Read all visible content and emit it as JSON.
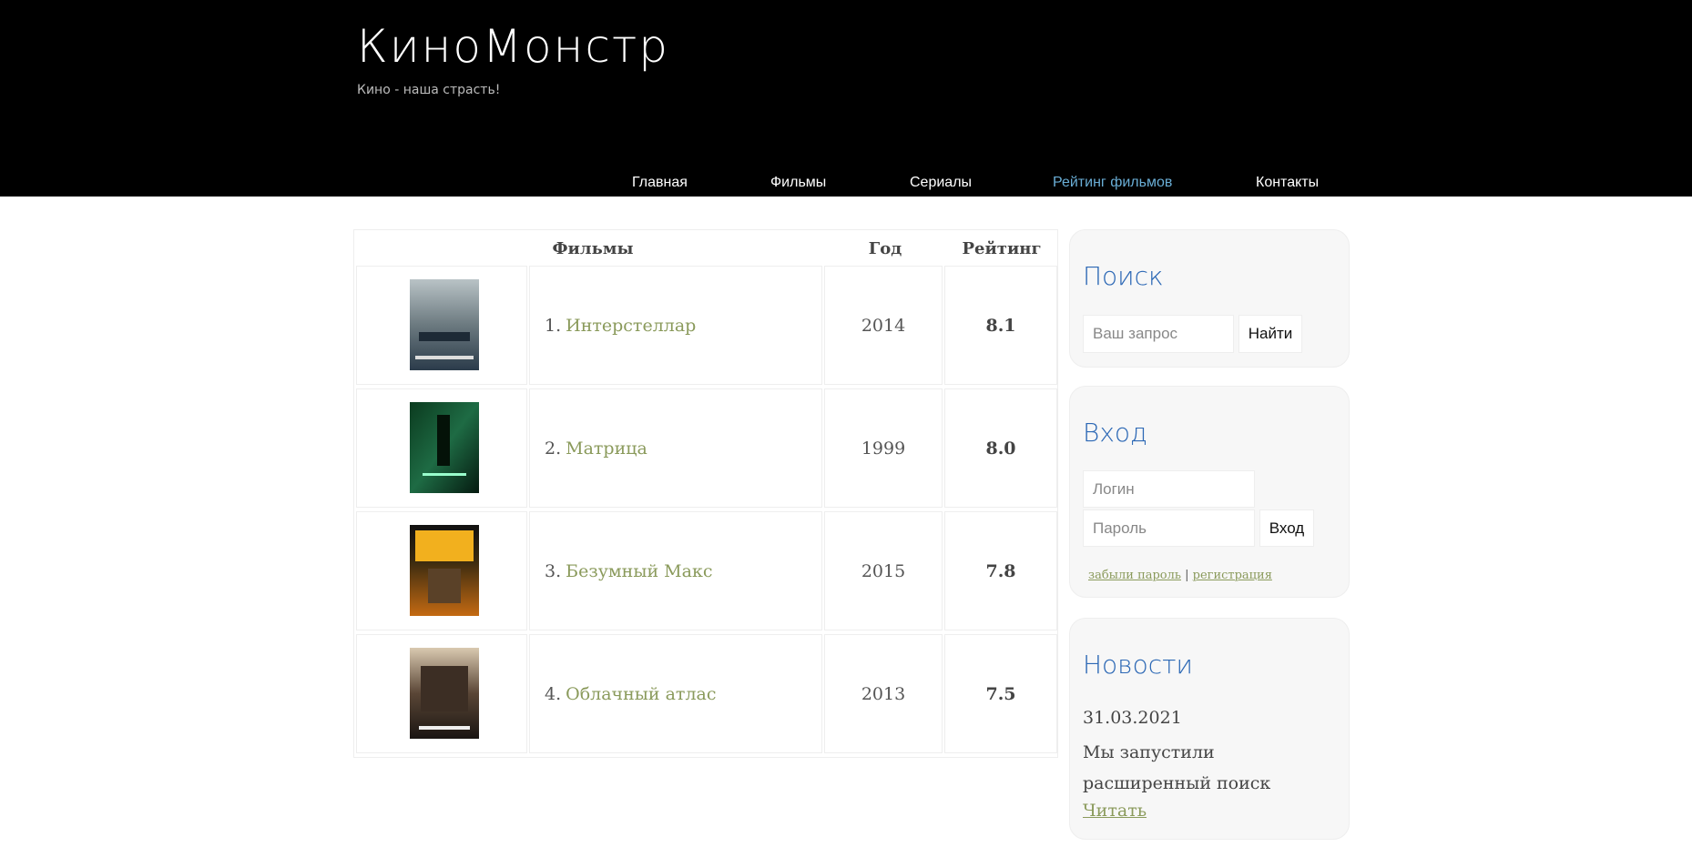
{
  "site": {
    "title": "КиноМонстр",
    "tagline": "Кино - наша страсть!"
  },
  "nav": [
    {
      "label": "Главная",
      "active": false
    },
    {
      "label": "Фильмы",
      "active": false
    },
    {
      "label": "Сериалы",
      "active": false
    },
    {
      "label": "Рейтинг фильмов",
      "active": true
    },
    {
      "label": "Контакты",
      "active": false
    }
  ],
  "table": {
    "headers": {
      "films": "Фильмы",
      "year": "Год",
      "rating": "Рейтинг"
    },
    "rows": [
      {
        "num": "1.",
        "title": "Интерстеллар",
        "year": "2014",
        "rating": "8.1",
        "poster": "poster-interstellar"
      },
      {
        "num": "2.",
        "title": "Матрица",
        "year": "1999",
        "rating": "8.0",
        "poster": "poster-matrix"
      },
      {
        "num": "3.",
        "title": "Безумный Макс",
        "year": "2015",
        "rating": "7.8",
        "poster": "poster-mad-max"
      },
      {
        "num": "4.",
        "title": "Облачный атлас",
        "year": "2013",
        "rating": "7.5",
        "poster": "poster-cloud-atlas"
      }
    ]
  },
  "search": {
    "heading": "Поиск",
    "placeholder": "Ваш запрос",
    "button": "Найти"
  },
  "login": {
    "heading": "Вход",
    "login_placeholder": "Логин",
    "password_placeholder": "Пароль",
    "button": "Вход",
    "forgot": "забыли пароль",
    "separator": "|",
    "register": "регистрация"
  },
  "news": {
    "heading": "Новости",
    "date": "31.03.2021",
    "text": "Мы запустили расширенный поиск",
    "read": "Читать"
  },
  "colors": {
    "header_bg": "#000000",
    "nav_active": "#6aaed6",
    "link": "#8a9a5b",
    "sidebar_heading": "#2c68b5"
  }
}
